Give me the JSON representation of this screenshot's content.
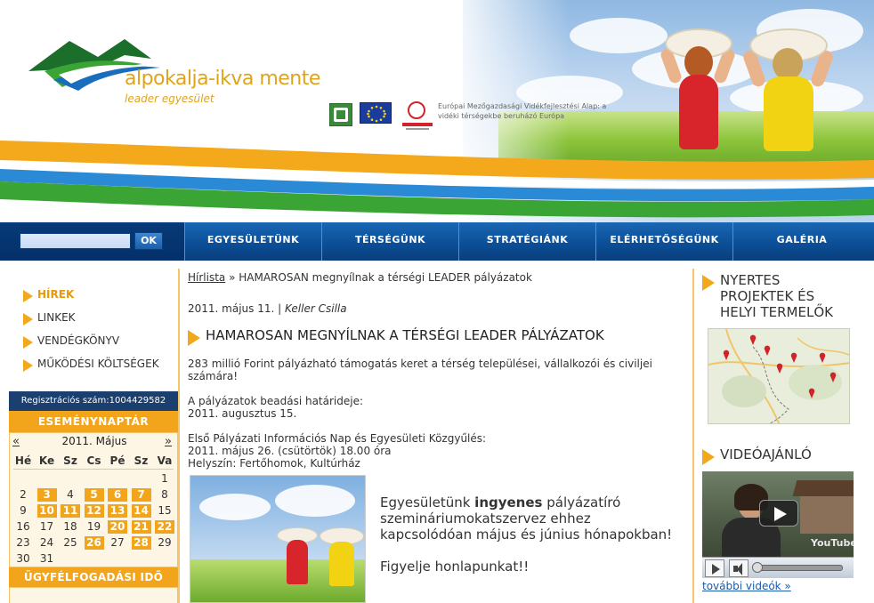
{
  "header": {
    "logo_title": "alpokalja-ikva mente",
    "logo_subtitle": "leader egyesület",
    "eu_text": "Európai Mezőgazdasági Vidékfejlesztési Alap: a vidéki térségekbe beruházó Európa",
    "colors": {
      "orange": "#f4a81c",
      "green": "#3aa535",
      "blue": "#1a6dbd"
    }
  },
  "search": {
    "value": "",
    "button": "OK"
  },
  "nav": {
    "items": [
      {
        "label": "EGYESÜLETÜNK"
      },
      {
        "label": "TÉRSÉGÜNK"
      },
      {
        "label": "STRATÉGIÁNK"
      },
      {
        "label": "ELÉRHETŐSÉGÜNK"
      },
      {
        "label": "GALÉRIA"
      }
    ]
  },
  "sidebar": {
    "menu": [
      {
        "label": "HÍREK",
        "active": true
      },
      {
        "label": "LINKEK",
        "active": false
      },
      {
        "label": "VENDÉGKÖNYV",
        "active": false
      },
      {
        "label": "MŰKÖDÉSI KÖLTSÉGEK",
        "active": false
      }
    ],
    "registration": "Regisztrációs szám:1004429582",
    "calendar": {
      "title": "ESEMÉNYNAPTÁR",
      "prev": "«",
      "next": "»",
      "month": "2011. Május",
      "days_of_week": [
        "Hé",
        "Ke",
        "Sz",
        "Cs",
        "Pé",
        "Sz",
        "Va"
      ],
      "weeks": [
        [
          "",
          "",
          "",
          "",
          "",
          "",
          "1"
        ],
        [
          "2",
          "3",
          "4",
          "5",
          "6",
          "7",
          "8"
        ],
        [
          "9",
          "10",
          "11",
          "12",
          "13",
          "14",
          "15"
        ],
        [
          "16",
          "17",
          "18",
          "19",
          "20",
          "21",
          "22"
        ],
        [
          "23",
          "24",
          "25",
          "26",
          "27",
          "28",
          "29"
        ],
        [
          "30",
          "31",
          "",
          "",
          "",
          "",
          ""
        ]
      ],
      "event_days": [
        "3",
        "5",
        "6",
        "7",
        "10",
        "11",
        "12",
        "13",
        "14",
        "20",
        "21",
        "22",
        "26",
        "28"
      ]
    },
    "office_hours_title": "ÜGYFÉLFOGADÁSI IDŐ"
  },
  "main": {
    "breadcrumb_link": "Hírlista",
    "breadcrumb_sep": " » ",
    "breadcrumb_current": "HAMAROSAN megnyílnak a térségi LEADER pályázatok",
    "date": "2011. május 11. | ",
    "author": "Keller Csilla",
    "title": "HAMAROSAN MEGNYÍLNAK A TÉRSÉGI LEADER PÁLYÁZATOK",
    "p1": "283 millió Forint pályázható támogatás keret a térség települései, vállalkozói és civiljei számára!",
    "p2_line1": "A pályázatok beadási határideje:",
    "p2_line2": "2011. augusztus 15.",
    "p3_line1": "Első Pályázati Információs Nap és Egyesületi Közgyűlés:",
    "p3_line2": "2011. május 26. (csütörtök) 18.00 óra",
    "p3_line3": "Helyszín: Fertőhomok, Kultúrház",
    "promo_pre": "Egyesületünk ",
    "promo_bold": "ingyenes",
    "promo_post": " pályázatíró szemináriumokatszervez ehhez kapcsolódóan május és június hónapokban!",
    "promo_line2": "Figyelje honlapunkat!!"
  },
  "right": {
    "projects_title_1": "NYERTES",
    "projects_title_2": "PROJEKTEK ÉS",
    "projects_title_3": "HELYI TERMELŐK",
    "video_title": "VIDEÓAJÁNLÓ",
    "youtube": "YouTube",
    "more_videos": "további videók »"
  }
}
